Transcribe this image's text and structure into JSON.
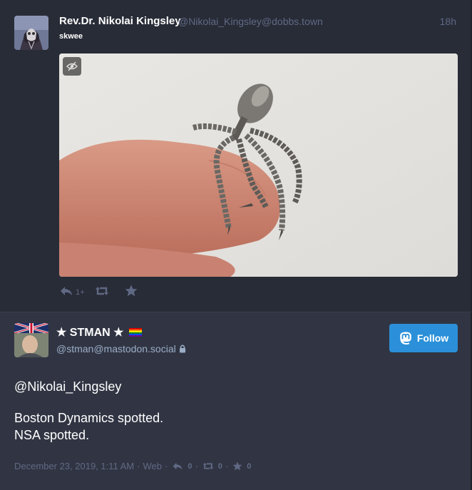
{
  "colors": {
    "background": "#282c37",
    "detail_background": "#313543",
    "accent": "#2b90d9",
    "muted": "#606984",
    "secondary": "#9baec8"
  },
  "status": {
    "display_name": "Rev.Dr. Nikolai Kingsley",
    "account": "@Nikolai_Kingsley@dobbs.town",
    "relative_time": "18h",
    "content": "skwee",
    "media_icon": "eye-slash-icon",
    "actions": {
      "reply_icon": "reply-icon",
      "reply_count": "1+",
      "boost_icon": "retweet-icon",
      "favourite_icon": "star-icon"
    }
  },
  "detail": {
    "display_name": "★ STMAN ★",
    "flag_icon": "rainbow-flag-icon",
    "account": "@stman@mastodon.social",
    "lock_icon": "lock-icon",
    "follow_label": "Follow",
    "follow_icon": "mastodon-icon",
    "paragraphs": [
      "@Nikolai_Kingsley",
      "Boston Dynamics spotted.\nNSA spotted."
    ],
    "meta": {
      "date": "December 23, 2019, 1:11 AM",
      "separator": "·",
      "application": "Web",
      "reply_count": "0",
      "boost_count": "0",
      "favourite_count": "0"
    }
  }
}
